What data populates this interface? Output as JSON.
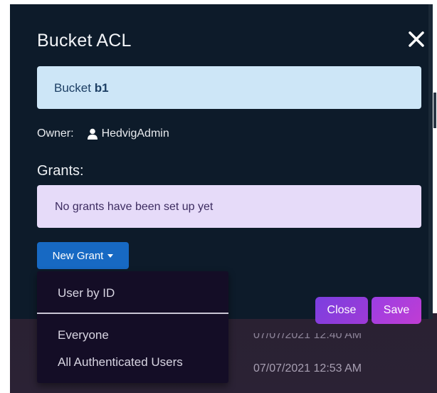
{
  "modal": {
    "title": "Bucket ACL",
    "bucket_banner": {
      "prefix": "Bucket ",
      "bucket_name": "b1"
    },
    "owner": {
      "label": "Owner:",
      "name": "HedvigAdmin"
    },
    "grants_heading": "Grants:",
    "grants_empty_message": "No grants have been set up yet",
    "new_grant_label": "New Grant",
    "close_label": "Close",
    "save_label": "Save"
  },
  "dropdown": {
    "items": [
      "User by ID",
      "Everyone",
      "All Authenticated Users"
    ]
  },
  "background": {
    "timestamps": [
      "07/07/2021 12:40 AM",
      "07/07/2021 12:53 AM"
    ]
  },
  "colors": {
    "modal_bg": "#0d1b2a",
    "info_banner": "#cde6f7",
    "grants_banner": "#e6dbf9",
    "primary_button": "#1769c3",
    "accent_purple": "#9e3ad6"
  },
  "icons": {
    "close": "close-icon",
    "owner": "user-icon",
    "dropdown": "caret-down-icon"
  }
}
